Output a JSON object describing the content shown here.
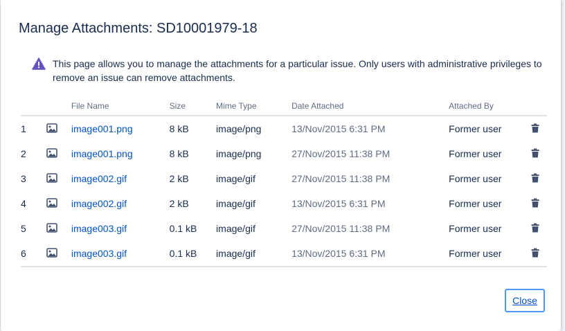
{
  "dialog": {
    "title": "Manage Attachments: SD10001979-18",
    "notice_icon": "warning-triangle-icon",
    "notice_text": "This page allows you to manage the attachments for a particular issue. Only users with administrative privileges to remove an issue can remove attachments.",
    "close_label": "Close"
  },
  "table": {
    "headers": {
      "file_name": "File Name",
      "size": "Size",
      "mime_type": "Mime Type",
      "date_attached": "Date Attached",
      "attached_by": "Attached By"
    },
    "rows": [
      {
        "index": "1",
        "file_name": "image001.png",
        "size": "8 kB",
        "mime_type": "image/png",
        "date": "13/Nov/2015 6:31 PM",
        "attached_by": "Former user"
      },
      {
        "index": "2",
        "file_name": "image001.png",
        "size": "8 kB",
        "mime_type": "image/png",
        "date": "27/Nov/2015 11:38 PM",
        "attached_by": "Former user"
      },
      {
        "index": "3",
        "file_name": "image002.gif",
        "size": "2 kB",
        "mime_type": "image/gif",
        "date": "27/Nov/2015 11:38 PM",
        "attached_by": "Former user"
      },
      {
        "index": "4",
        "file_name": "image002.gif",
        "size": "2 kB",
        "mime_type": "image/gif",
        "date": "13/Nov/2015 6:31 PM",
        "attached_by": "Former user"
      },
      {
        "index": "5",
        "file_name": "image003.gif",
        "size": "0.1 kB",
        "mime_type": "image/gif",
        "date": "27/Nov/2015 11:38 PM",
        "attached_by": "Former user"
      },
      {
        "index": "6",
        "file_name": "image003.gif",
        "size": "0.1 kB",
        "mime_type": "image/gif",
        "date": "13/Nov/2015 6:31 PM",
        "attached_by": "Former user"
      }
    ],
    "row_icon": "image-file-icon",
    "delete_icon": "trash-icon"
  },
  "colors": {
    "link": "#0052cc",
    "text": "#172b4d",
    "muted": "#5e6c84",
    "warning": "#6554c0",
    "focus": "#4c9aff"
  }
}
